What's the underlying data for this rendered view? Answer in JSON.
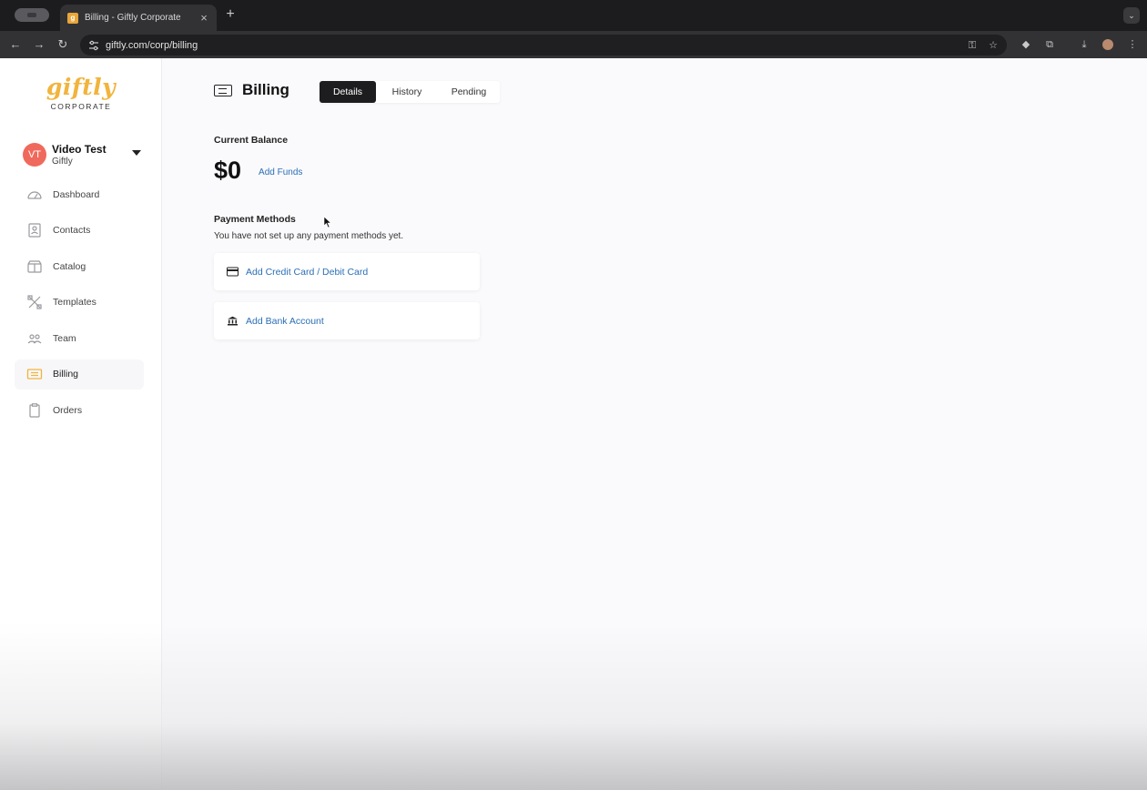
{
  "browser": {
    "tab_title": "Billing - Giftly Corporate",
    "tab_close": "×",
    "new_tab": "+",
    "url": "giftly.com/corp/billing",
    "back": "←",
    "forward": "→",
    "reload": "↻"
  },
  "sidebar": {
    "logo": "giftly",
    "logo_sub": "CORPORATE",
    "account": {
      "initials": "VT",
      "name": "Video Test",
      "org": "Giftly"
    },
    "items": [
      {
        "label": "Dashboard",
        "icon": "dashboard-icon"
      },
      {
        "label": "Contacts",
        "icon": "contacts-icon"
      },
      {
        "label": "Catalog",
        "icon": "catalog-icon"
      },
      {
        "label": "Templates",
        "icon": "templates-icon"
      },
      {
        "label": "Team",
        "icon": "team-icon"
      },
      {
        "label": "Billing",
        "icon": "billing-icon",
        "active": true
      },
      {
        "label": "Orders",
        "icon": "orders-icon"
      }
    ]
  },
  "main": {
    "title": "Billing",
    "tabs": [
      {
        "label": "Details",
        "active": true
      },
      {
        "label": "History"
      },
      {
        "label": "Pending"
      }
    ],
    "current_balance_label": "Current Balance",
    "balance": "$0",
    "add_funds": "Add Funds",
    "payment_methods_label": "Payment Methods",
    "payment_methods_empty": "You have not set up any payment methods yet.",
    "add_card": "Add Credit Card / Debit Card",
    "add_bank": "Add Bank Account"
  },
  "colors": {
    "accent_link": "#2a6fb5",
    "logo": "#f1b43d",
    "avatar": "#ef6a5c",
    "active_tab": "#1d1d1f"
  }
}
